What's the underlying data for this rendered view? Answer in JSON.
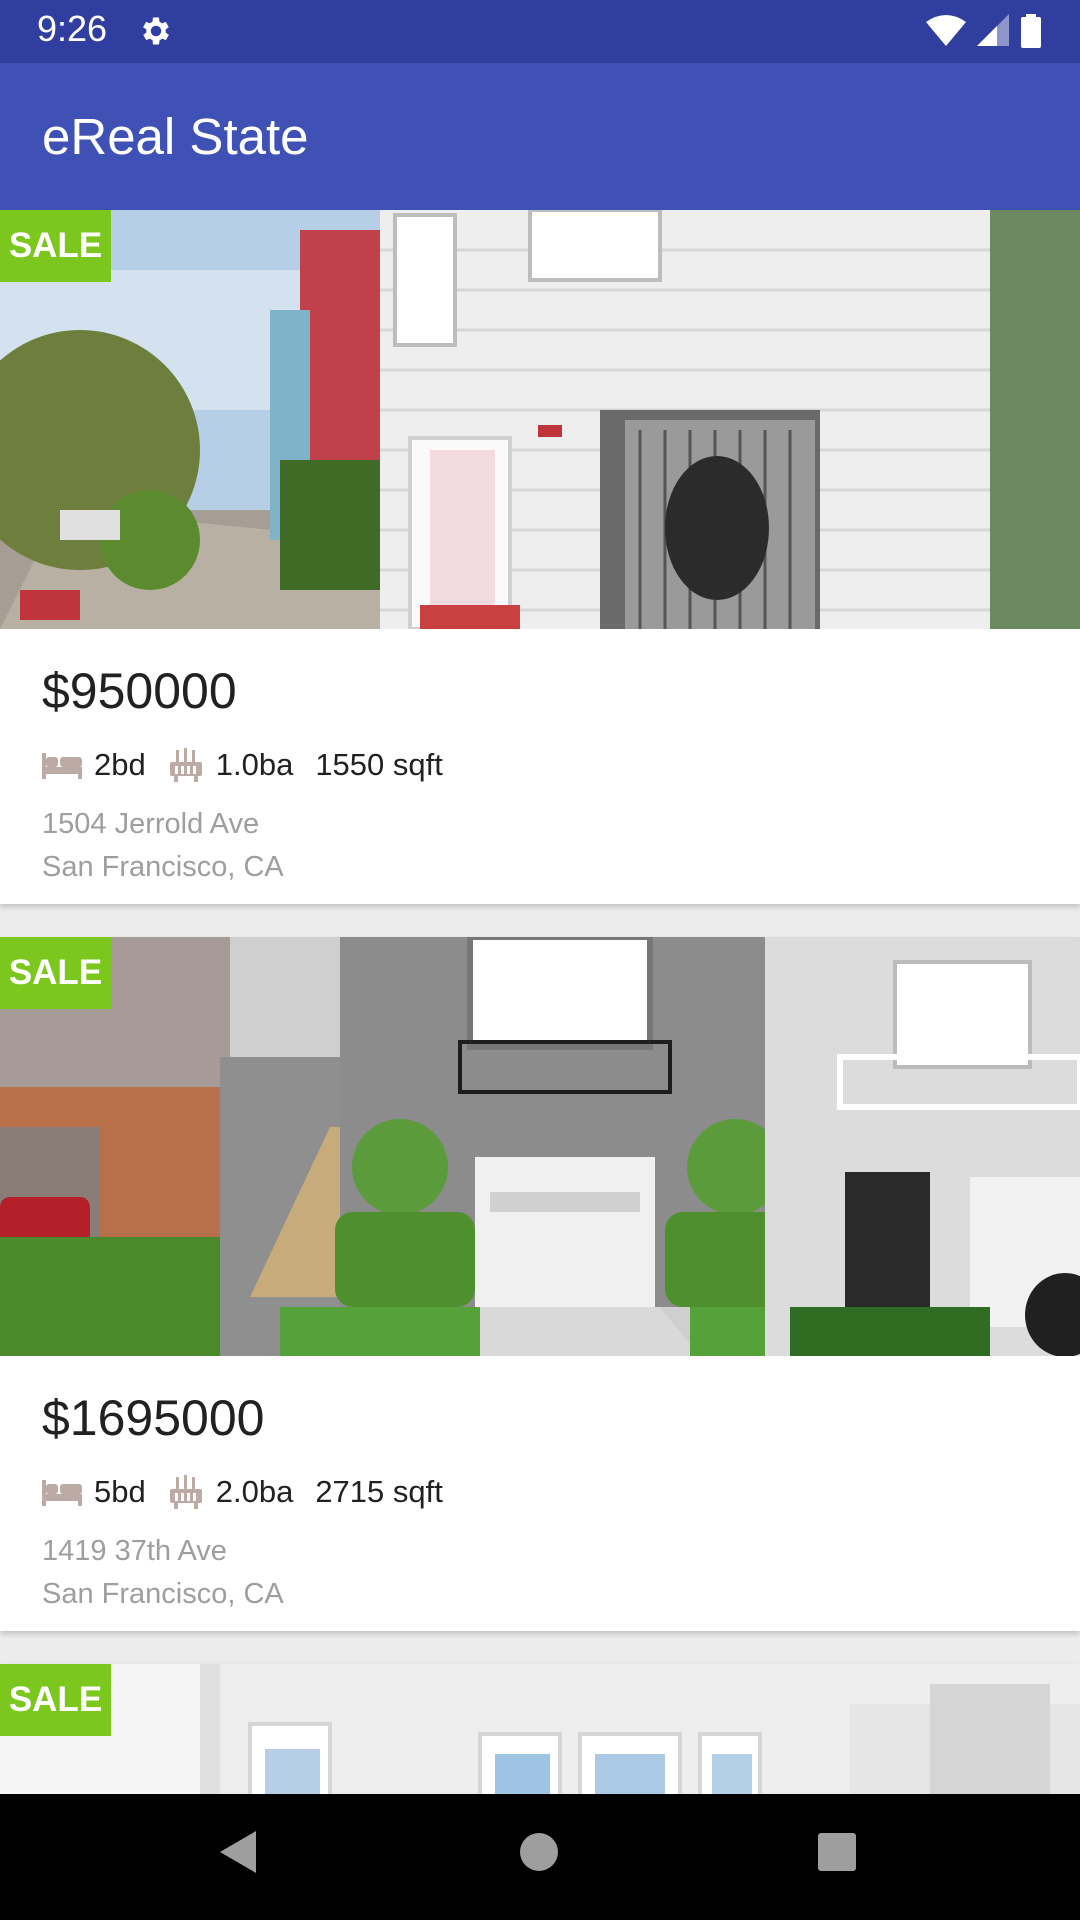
{
  "status_bar": {
    "time": "9:26",
    "icons": [
      "settings-icon",
      "wifi-icon",
      "signal-icon",
      "battery-icon"
    ]
  },
  "app_bar": {
    "title": "eReal State"
  },
  "listings": [
    {
      "badge": "SALE",
      "price": "$950000",
      "beds": "2bd",
      "baths": "1.0ba",
      "area": "1550 sqft",
      "street": "1504 Jerrold Ave",
      "city": "San Francisco, CA"
    },
    {
      "badge": "SALE",
      "price": "$1695000",
      "beds": "5bd",
      "baths": "2.0ba",
      "area": "2715 sqft",
      "street": "1419 37th Ave",
      "city": "San Francisco, CA"
    },
    {
      "badge": "SALE"
    }
  ],
  "colors": {
    "primary": "#3f51b5",
    "primary_dark": "#303f9f",
    "sale_badge": "#7cc71d",
    "icon_tint": "#bcaaa4"
  },
  "nav_bar": {
    "buttons": [
      "back-icon",
      "home-icon",
      "recents-icon"
    ]
  }
}
